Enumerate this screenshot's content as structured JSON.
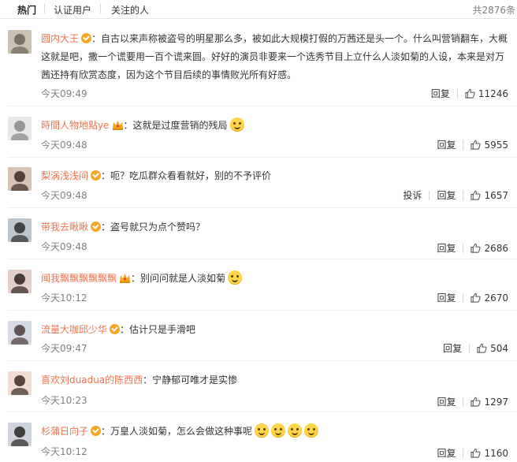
{
  "tabs": [
    {
      "label": "热门",
      "active": true
    },
    {
      "label": "认证用户",
      "active": false
    },
    {
      "label": "关注的人",
      "active": false
    }
  ],
  "total": "共2876条",
  "reply_label": "回复",
  "report_label": "投诉",
  "colors": {
    "username": "#eb7350",
    "muted": "#808080",
    "badge_gold": "#f5a623"
  },
  "comments": [
    {
      "user": "圆内大王",
      "badge": "v",
      "content": "：自古以来声称被盗号的明星那么多，被如此大规模打假的万茜还是头一个。什么叫营销翻车，大概这就是吧，撒一个谎要用一百个谎来圆。好好的演员非要来一个选秀节目上立什么人淡如菊的人设，本来是对万茜还持有欣赏态度，因为这个节目后续的事情败光所有好感。",
      "emojis": 0,
      "time": "今天09:49",
      "likes": "11246",
      "report": false,
      "avatar": "cat-avatar"
    },
    {
      "user": "時間人物地點ye",
      "badge": "crown",
      "content": "：这就是过度营销的残局",
      "emojis": 1,
      "time": "今天09:48",
      "likes": "5955",
      "report": false,
      "avatar": "cartoon-avatar"
    },
    {
      "user": "梨涡浅浅间",
      "badge": "v",
      "content": "：呃？吃瓜群众看看就好，别的不予评价",
      "emojis": 0,
      "time": "今天09:48",
      "likes": "1657",
      "report": true,
      "avatar": "girl-avatar"
    },
    {
      "user": "带我去瞅瞅",
      "badge": "v",
      "content": "：盗号就只为点个赞吗？",
      "emojis": 0,
      "time": "今天09:48",
      "likes": "2686",
      "report": false,
      "avatar": "portrait-avatar"
    },
    {
      "user": "闻我飘飘飘飘飘飘",
      "badge": "crown",
      "content": "：别问问就是人淡如菊",
      "emojis": 1,
      "time": "今天10:12",
      "likes": "2670",
      "report": false,
      "avatar": "girl-avatar-2"
    },
    {
      "user": "流量大咖邱少华",
      "badge": "v",
      "content": "：估计只是手滑吧",
      "emojis": 0,
      "time": "今天09:47",
      "likes": "504",
      "report": false,
      "avatar": "boy-avatar"
    },
    {
      "user": "喜欢刘duadua的陈西西",
      "badge": "none",
      "content": "：宁静郁可唯才是实惨",
      "emojis": 0,
      "time": "今天10:23",
      "likes": "1297",
      "report": false,
      "avatar": "girl-avatar-3"
    },
    {
      "user": "杉蒲日向子",
      "badge": "v",
      "content": "：万皇人淡如菊，怎么会做这种事呢",
      "emojis": 4,
      "time": "今天10:12",
      "likes": "1160",
      "report": false,
      "avatar": "girl-avatar-4"
    }
  ]
}
